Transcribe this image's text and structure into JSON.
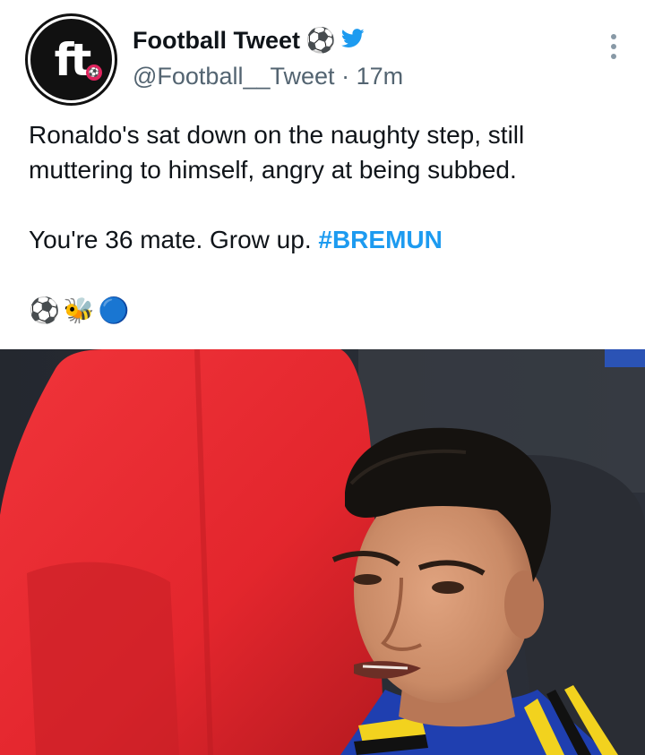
{
  "author": {
    "avatar_text": "ft",
    "name": "Football Tweet",
    "name_icons": [
      "soccer-ball-icon",
      "twitter-bird-icon"
    ],
    "handle": "@Football__Tweet",
    "separator": "·",
    "time": "17m"
  },
  "tweet": {
    "line1": "Ronaldo's sat down on the naughty step, still",
    "line2": "muttering to himself, angry at being subbed.",
    "line3_text": "You're 36 mate. Grow up. ",
    "hashtag": "#BREMUN",
    "emojis": [
      "⚽",
      "🐝",
      "🔵"
    ]
  },
  "colors": {
    "link": "#1d9bf0",
    "seat_red": "#e8262f",
    "jersey_blue": "#1f3fb0",
    "jersey_yellow": "#f2d21e"
  }
}
